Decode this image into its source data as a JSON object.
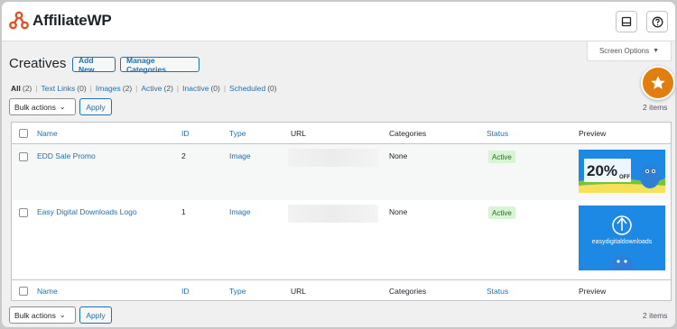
{
  "app": {
    "logo_text": "AffiliateWP"
  },
  "header": {
    "icons": [
      "inbox-icon",
      "help-icon"
    ],
    "screen_options_label": "Screen Options"
  },
  "page": {
    "title": "Creatives",
    "add_new_label": "Add New",
    "manage_categories_label": "Manage Categories"
  },
  "filters": [
    {
      "label": "All",
      "count": "(2)",
      "current": true
    },
    {
      "label": "Text Links",
      "count": "(0)",
      "current": false
    },
    {
      "label": "Images",
      "count": "(2)",
      "current": false
    },
    {
      "label": "Active",
      "count": "(2)",
      "current": false
    },
    {
      "label": "Inactive",
      "count": "(0)",
      "current": false
    },
    {
      "label": "Scheduled",
      "count": "(0)",
      "current": false
    }
  ],
  "bulk": {
    "label": "Bulk actions",
    "apply_label": "Apply"
  },
  "items_count": "2 items",
  "table": {
    "columns": [
      "Name",
      "ID",
      "Type",
      "URL",
      "Categories",
      "Status",
      "Preview"
    ],
    "rows": [
      {
        "name": "EDD Sale Promo",
        "id": "2",
        "type": "Image",
        "categories": "None",
        "status": "Active",
        "preview": {
          "big_text": "20%",
          "small_text": "OFF"
        }
      },
      {
        "name": "Easy Digital Downloads Logo",
        "id": "1",
        "type": "Image",
        "categories": "None",
        "status": "Active",
        "preview": {
          "brand_text": "easydigitaldownloads"
        }
      }
    ]
  },
  "colors": {
    "accent": "#2271b1",
    "badge": "#e27d0f",
    "active_bg": "#d8f5d3",
    "preview_blue": "#1e88e5"
  }
}
